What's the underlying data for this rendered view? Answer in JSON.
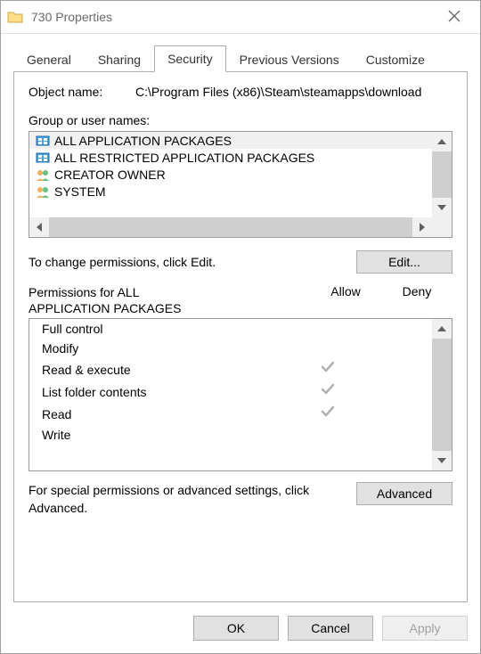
{
  "window": {
    "title": "730 Properties"
  },
  "tabs": [
    {
      "label": "General"
    },
    {
      "label": "Sharing"
    },
    {
      "label": "Security"
    },
    {
      "label": "Previous Versions"
    },
    {
      "label": "Customize"
    }
  ],
  "active_tab_index": 2,
  "object_name_label": "Object name:",
  "object_name_value": "C:\\Program Files (x86)\\Steam\\steamapps\\download",
  "group_label": "Group or user names:",
  "users": [
    {
      "icon": "pkg",
      "label": "ALL APPLICATION PACKAGES",
      "selected": true
    },
    {
      "icon": "pkg",
      "label": "ALL RESTRICTED APPLICATION PACKAGES",
      "selected": false
    },
    {
      "icon": "people",
      "label": "CREATOR OWNER",
      "selected": false
    },
    {
      "icon": "people",
      "label": "SYSTEM",
      "selected": false
    }
  ],
  "edit_hint": "To change permissions, click Edit.",
  "edit_button": "Edit...",
  "perm_title_prefix": "Permissions for ALL",
  "perm_title_line2": "APPLICATION PACKAGES",
  "col_allow": "Allow",
  "col_deny": "Deny",
  "permissions": [
    {
      "name": "Full control",
      "allow": false,
      "deny": false
    },
    {
      "name": "Modify",
      "allow": false,
      "deny": false
    },
    {
      "name": "Read & execute",
      "allow": true,
      "deny": false
    },
    {
      "name": "List folder contents",
      "allow": true,
      "deny": false
    },
    {
      "name": "Read",
      "allow": true,
      "deny": false
    },
    {
      "name": "Write",
      "allow": false,
      "deny": false
    }
  ],
  "advanced_hint": "For special permissions or advanced settings, click Advanced.",
  "advanced_button": "Advanced",
  "footer": {
    "ok": "OK",
    "cancel": "Cancel",
    "apply": "Apply"
  }
}
